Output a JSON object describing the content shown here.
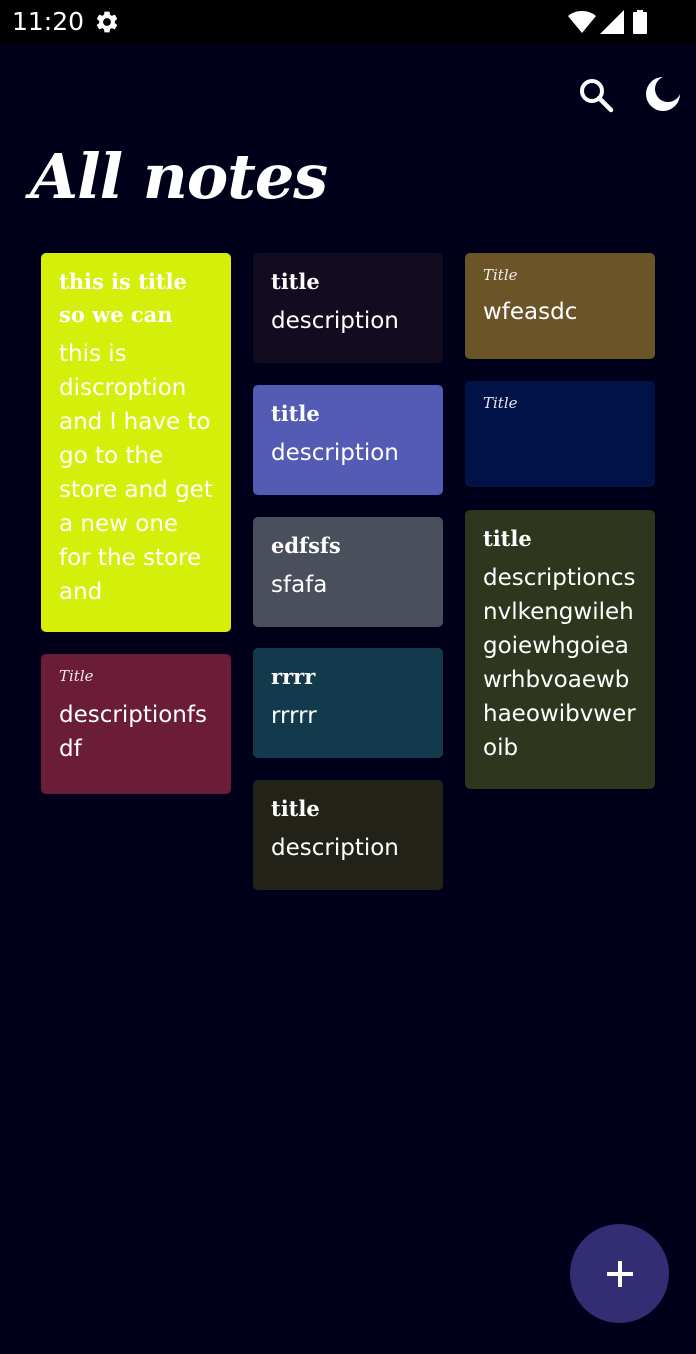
{
  "status": {
    "time": "11:20"
  },
  "header": {
    "title": "All notes"
  },
  "notes": [
    {
      "title": "this is title so we can",
      "description": "this is discroption and I have to go to the store and get a new one for the store and",
      "color": "#d4f00a"
    },
    {
      "title": "Title",
      "description": "descriptionfsdf",
      "color": "#6b1d38"
    },
    {
      "title": "title",
      "description": "description",
      "color": "#130b20"
    },
    {
      "title": "title",
      "description": "description",
      "color": "#535bb5"
    },
    {
      "title": "edfsfs",
      "description": "sfafa",
      "color": "#4a4f5c"
    },
    {
      "title": "rrrr",
      "description": "rrrrr",
      "color": "#133a4c"
    },
    {
      "title": "title",
      "description": "description",
      "color": "#222218"
    },
    {
      "title": "Title",
      "description": "wfeasdc",
      "color": "#6a5428"
    },
    {
      "title": "Title",
      "description": "",
      "color": "#011249"
    },
    {
      "title": "title",
      "description": "descriptioncsnvlkengwilehgoiewhgoieawrhbvoaewbhaeowibvweroib",
      "color": "#2e361d"
    }
  ],
  "colors": {
    "background": "#00001a",
    "fab": "#332d73"
  },
  "icons": [
    "settings-gear-icon",
    "wifi-icon",
    "signal-icon",
    "battery-icon",
    "search-icon",
    "moon-icon",
    "plus-icon"
  ]
}
